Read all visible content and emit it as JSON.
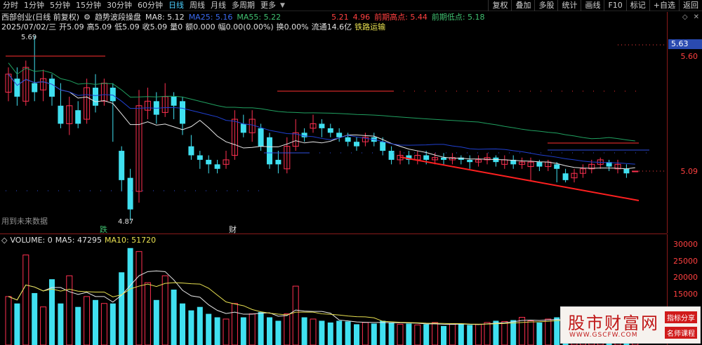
{
  "toolbar": {
    "items": [
      "分时",
      "1分钟",
      "5分钟",
      "15分钟",
      "30分钟",
      "60分钟",
      "日线",
      "周线",
      "月线",
      "多周期",
      "更多"
    ],
    "active": "日线",
    "right_buttons": [
      "复权",
      "叠加",
      "多股",
      "统计",
      "画线",
      "F10",
      "标记",
      "+自选",
      "返回"
    ]
  },
  "header": {
    "stock_name": "西部创业(日线 前复权)",
    "indicator": "趋势波段操盘",
    "ma8": "MA8: 5.12",
    "ma25": "MA25: 5.16",
    "ma55": "MA55: 5.22",
    "val1": "5.21",
    "val2": "4.96",
    "prev_high_label": "前期高点: 5.44",
    "prev_low_label": "前期低点: 5.18"
  },
  "info_line": {
    "date": "2025/07/02/三",
    "open": "开5.09",
    "high": "高5.09",
    "low": "低5.09",
    "close": "收5.09",
    "vol": "量0",
    "amount": "额0.000",
    "amp": "幅0.00(0.00%)",
    "turnover": "换0.00%",
    "float": "流通14.6亿",
    "concept": "铁路运输"
  },
  "axis": {
    "price_box": "5.63",
    "p1": "5.60",
    "p2": "5.09",
    "vol_labels": [
      "30000",
      "25000",
      "20000",
      "15000"
    ]
  },
  "labels": {
    "high_marker": "5.69",
    "low_marker": "4.87",
    "note": "用到未来数据",
    "die": "跌",
    "cai": "财"
  },
  "volume_header": {
    "volume": "VOLUME: 0",
    "ma5": "MA5: 47295",
    "ma10": "MA10: 51720"
  },
  "watermark": {
    "title": "股市财富网",
    "url": "WWW.GSCFW.COM",
    "tag1": "指标分享",
    "tag2": "名师课程"
  },
  "colors": {
    "up": "#ff3050",
    "down": "#40e0f0",
    "ma8": "#e8e8e8",
    "ma25": "#2040d0",
    "ma55": "#20a060",
    "support": "#ff2020"
  }
}
